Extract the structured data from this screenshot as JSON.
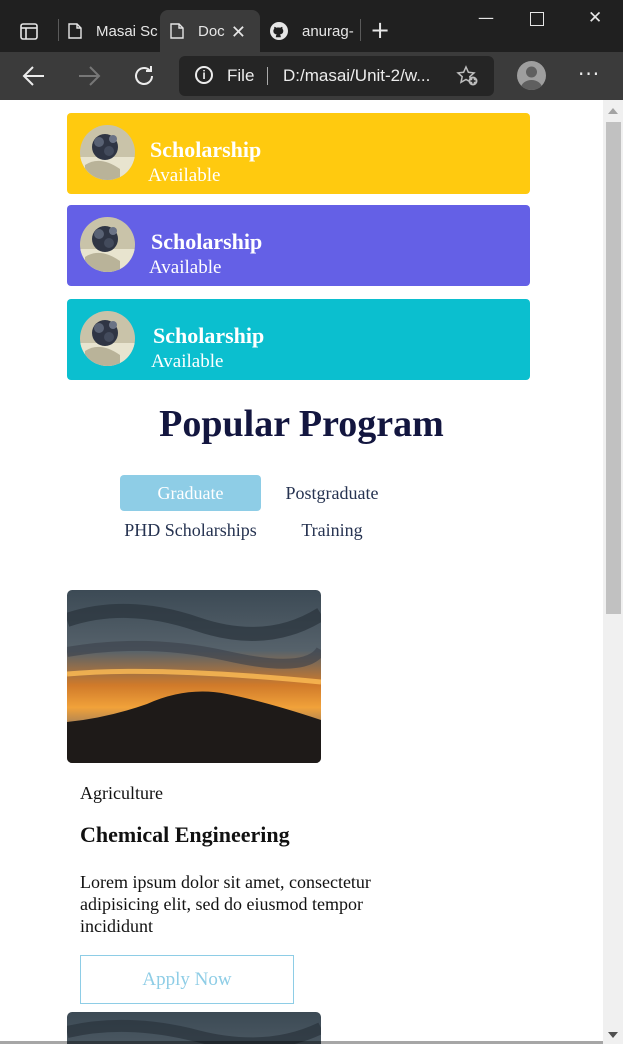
{
  "browser": {
    "tabs": [
      {
        "title": "Masai Sc",
        "icon": "page-icon"
      },
      {
        "title": "Doc",
        "icon": "page-icon",
        "active": true
      },
      {
        "title": "anurag-",
        "icon": "github-icon"
      }
    ],
    "address": {
      "scheme": "File",
      "url": "D:/masai/Unit-2/w..."
    },
    "colors": {
      "tabbar": "#202020",
      "toolbar": "#3b3b3b"
    }
  },
  "scholarships": [
    {
      "title": "Scholarship",
      "subtitle": "Available",
      "color": "#ffca0f"
    },
    {
      "title": "Scholarship",
      "subtitle": "Available",
      "color": "#6460e6"
    },
    {
      "title": "Scholarship",
      "subtitle": "Available",
      "color": "#0bbfcf"
    }
  ],
  "popular": {
    "title": "Popular Program",
    "tabs": [
      {
        "label": "Graduate",
        "active": true
      },
      {
        "label": "Postgraduate"
      },
      {
        "label": "PHD Scholarships"
      },
      {
        "label": "Training"
      }
    ]
  },
  "program": {
    "category": "Agriculture",
    "name": "Chemical Engineering",
    "description": "Lorem ipsum dolor sit amet, consectetur adipisicing elit, sed do eiusmod tempor incididunt",
    "apply_label": "Apply Now"
  },
  "colors": {
    "title": "#13163f",
    "accent": "#8ecde6"
  }
}
